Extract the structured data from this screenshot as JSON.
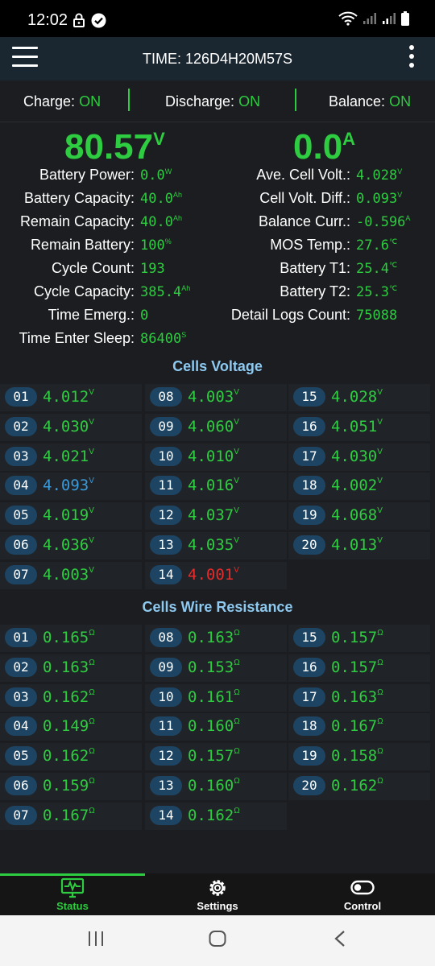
{
  "status_bar": {
    "time": "12:02"
  },
  "app_bar": {
    "title": "TIME: 126D4H20M57S"
  },
  "toggles": [
    {
      "label": "Charge:",
      "state": "ON"
    },
    {
      "label": "Discharge:",
      "state": "ON"
    },
    {
      "label": "Balance:",
      "state": "ON"
    }
  ],
  "summary": {
    "voltage": "80.57",
    "voltage_unit": "V",
    "current": "0.0",
    "current_unit": "A"
  },
  "left_info": [
    {
      "label": "Battery Power:",
      "value": "0.0",
      "unit": "W"
    },
    {
      "label": "Battery Capacity:",
      "value": "40.0",
      "unit": "Ah"
    },
    {
      "label": "Remain Capacity:",
      "value": "40.0",
      "unit": "Ah"
    },
    {
      "label": "Remain Battery:",
      "value": "100",
      "unit": "%"
    },
    {
      "label": "Cycle Count:",
      "value": "193",
      "unit": ""
    },
    {
      "label": "Cycle Capacity:",
      "value": "385.4",
      "unit": "Ah"
    },
    {
      "label": "Time Emerg.:",
      "value": "0",
      "unit": ""
    },
    {
      "label": "Time Enter Sleep:",
      "value": "86400",
      "unit": "S"
    }
  ],
  "right_info": [
    {
      "label": "Ave. Cell Volt.:",
      "value": "4.028",
      "unit": "V"
    },
    {
      "label": "Cell Volt. Diff.:",
      "value": "0.093",
      "unit": "V"
    },
    {
      "label": "Balance Curr.:",
      "value": "-0.596",
      "unit": "A"
    },
    {
      "label": "MOS Temp.:",
      "value": "27.6",
      "unit": "℃"
    },
    {
      "label": "Battery T1:",
      "value": "25.4",
      "unit": "℃"
    },
    {
      "label": "Battery T2:",
      "value": "25.3",
      "unit": "℃"
    },
    {
      "label": "Detail Logs Count:",
      "value": "75088",
      "unit": ""
    }
  ],
  "cells_voltage": {
    "title": "Cells Voltage",
    "unit": "V",
    "colors": {
      "normal": "#2ecc40",
      "max": "#3a9ad9",
      "min": "#e52b2b"
    },
    "cells": [
      {
        "id": "01",
        "value": "4.012",
        "flag": "normal"
      },
      {
        "id": "02",
        "value": "4.030",
        "flag": "normal"
      },
      {
        "id": "03",
        "value": "4.021",
        "flag": "normal"
      },
      {
        "id": "04",
        "value": "4.093",
        "flag": "max"
      },
      {
        "id": "05",
        "value": "4.019",
        "flag": "normal"
      },
      {
        "id": "06",
        "value": "4.036",
        "flag": "normal"
      },
      {
        "id": "07",
        "value": "4.003",
        "flag": "normal"
      },
      {
        "id": "08",
        "value": "4.003",
        "flag": "normal"
      },
      {
        "id": "09",
        "value": "4.060",
        "flag": "normal"
      },
      {
        "id": "10",
        "value": "4.010",
        "flag": "normal"
      },
      {
        "id": "11",
        "value": "4.016",
        "flag": "normal"
      },
      {
        "id": "12",
        "value": "4.037",
        "flag": "normal"
      },
      {
        "id": "13",
        "value": "4.035",
        "flag": "normal"
      },
      {
        "id": "14",
        "value": "4.001",
        "flag": "min"
      },
      {
        "id": "15",
        "value": "4.028",
        "flag": "normal"
      },
      {
        "id": "16",
        "value": "4.051",
        "flag": "normal"
      },
      {
        "id": "17",
        "value": "4.030",
        "flag": "normal"
      },
      {
        "id": "18",
        "value": "4.002",
        "flag": "normal"
      },
      {
        "id": "19",
        "value": "4.068",
        "flag": "normal"
      },
      {
        "id": "20",
        "value": "4.013",
        "flag": "normal"
      }
    ]
  },
  "cells_resistance": {
    "title": "Cells Wire Resistance",
    "unit": "Ω",
    "cells": [
      {
        "id": "01",
        "value": "0.165"
      },
      {
        "id": "02",
        "value": "0.163"
      },
      {
        "id": "03",
        "value": "0.162"
      },
      {
        "id": "04",
        "value": "0.149"
      },
      {
        "id": "05",
        "value": "0.162"
      },
      {
        "id": "06",
        "value": "0.159"
      },
      {
        "id": "07",
        "value": "0.167"
      },
      {
        "id": "08",
        "value": "0.163"
      },
      {
        "id": "09",
        "value": "0.153"
      },
      {
        "id": "10",
        "value": "0.161"
      },
      {
        "id": "11",
        "value": "0.160"
      },
      {
        "id": "12",
        "value": "0.157"
      },
      {
        "id": "13",
        "value": "0.160"
      },
      {
        "id": "14",
        "value": "0.162"
      },
      {
        "id": "15",
        "value": "0.157"
      },
      {
        "id": "16",
        "value": "0.157"
      },
      {
        "id": "17",
        "value": "0.163"
      },
      {
        "id": "18",
        "value": "0.167"
      },
      {
        "id": "19",
        "value": "0.158"
      },
      {
        "id": "20",
        "value": "0.162"
      }
    ]
  },
  "bottom_nav": {
    "items": [
      {
        "label": "Status",
        "icon": "monitor-pulse-icon",
        "active": true
      },
      {
        "label": "Settings",
        "icon": "gear-icon",
        "active": false
      },
      {
        "label": "Control",
        "icon": "toggle-icon",
        "active": false
      }
    ],
    "colors": {
      "active": "#2ecc40",
      "inactive": "#ffffff"
    }
  },
  "system_nav": {
    "items": [
      "recent-apps-icon",
      "home-icon",
      "back-icon"
    ]
  }
}
